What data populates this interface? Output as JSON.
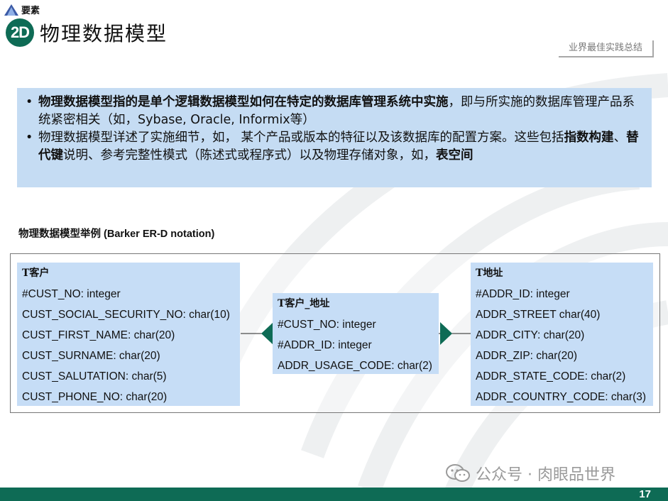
{
  "header": {
    "tag": "要素",
    "badge": "2D",
    "title": "物理数据模型",
    "best_practice": "业界最佳实践总结"
  },
  "info": {
    "b1_bold": "物理数据模型指的是单个逻辑数据模型如何在特定的数据库管理系统中实施",
    "b1_rest": "，即与所实施的数据库管理产品系统紧密相关（如，Sybase, Oracle, Informix等）",
    "b2_pre": "物理数据模型详述了实施细节，如， 某个产品或版本的特征以及该数据库的配置方案。这些包括",
    "b2_bold1": "指数构建",
    "b2_sep": "、",
    "b2_bold2": "替代键",
    "b2_mid": "说明、参考完整性模式（陈述式或程序式）以及物理存储对象，如，",
    "b2_bold3": "表空间"
  },
  "diagram": {
    "caption": "物理数据模型举例 (Barker ER-D notation)",
    "customer": {
      "name": "T客户",
      "attrs": [
        "#CUST_NO: integer",
        "CUST_SOCIAL_SECURITY_NO:  char(10)",
        "CUST_FIRST_NAME:  char(20)",
        "CUST_SURNAME: char(20)",
        "CUST_SALUTATION:  char(5)",
        "CUST_PHONE_NO:  char(20)"
      ]
    },
    "link": {
      "name": "T客户_地址",
      "attrs": [
        "#CUST_NO: integer",
        "#ADDR_ID: integer",
        "ADDR_USAGE_CODE: char(2)"
      ]
    },
    "address": {
      "name": "T地址",
      "attrs": [
        "#ADDR_ID: integer",
        "ADDR_STREET char(40)",
        "ADDR_CITY:  char(20)",
        "ADDR_ZIP: char(20)",
        "ADDR_STATE_CODE: char(2)",
        "ADDR_COUNTRY_CODE:  char(3)"
      ]
    }
  },
  "footer": {
    "page": "17",
    "watermark": "公众号 · 肉眼品世界"
  },
  "colors": {
    "accent": "#0e6b55",
    "box": "#c5dcf3"
  }
}
